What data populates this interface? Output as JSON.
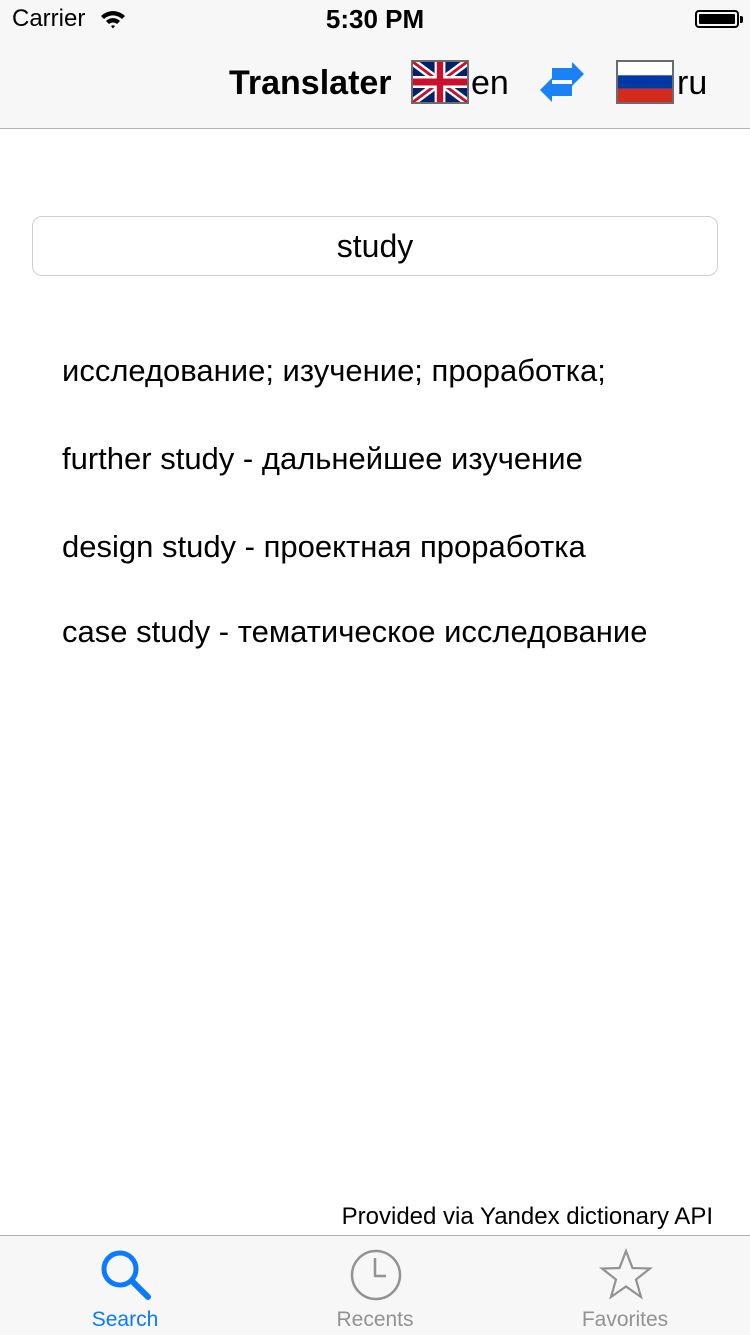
{
  "status_bar": {
    "carrier": "Carrier",
    "time": "5:30 PM"
  },
  "nav": {
    "title": "Translater",
    "source_lang": {
      "code": "en",
      "flag": "uk-flag-icon"
    },
    "target_lang": {
      "code": "ru",
      "flag": "russia-flag-icon"
    },
    "swap_icon": "swap-arrows-icon"
  },
  "search": {
    "value": "study"
  },
  "results": [
    "исследование; изучение; проработка;",
    "further study - дальнейшее изучение",
    "design study - проектная проработка",
    "case study - тематическое исследование"
  ],
  "footer": {
    "provider": "Provided via Yandex dictionary API"
  },
  "tab_bar": {
    "tabs": [
      {
        "label": "Search",
        "icon": "search-icon",
        "active": true
      },
      {
        "label": "Recents",
        "icon": "clock-icon",
        "active": false
      },
      {
        "label": "Favorites",
        "icon": "star-icon",
        "active": false
      }
    ]
  },
  "colors": {
    "accent": "#0a7aff",
    "inactive": "#929292",
    "bar_bg": "#f7f7f7"
  }
}
